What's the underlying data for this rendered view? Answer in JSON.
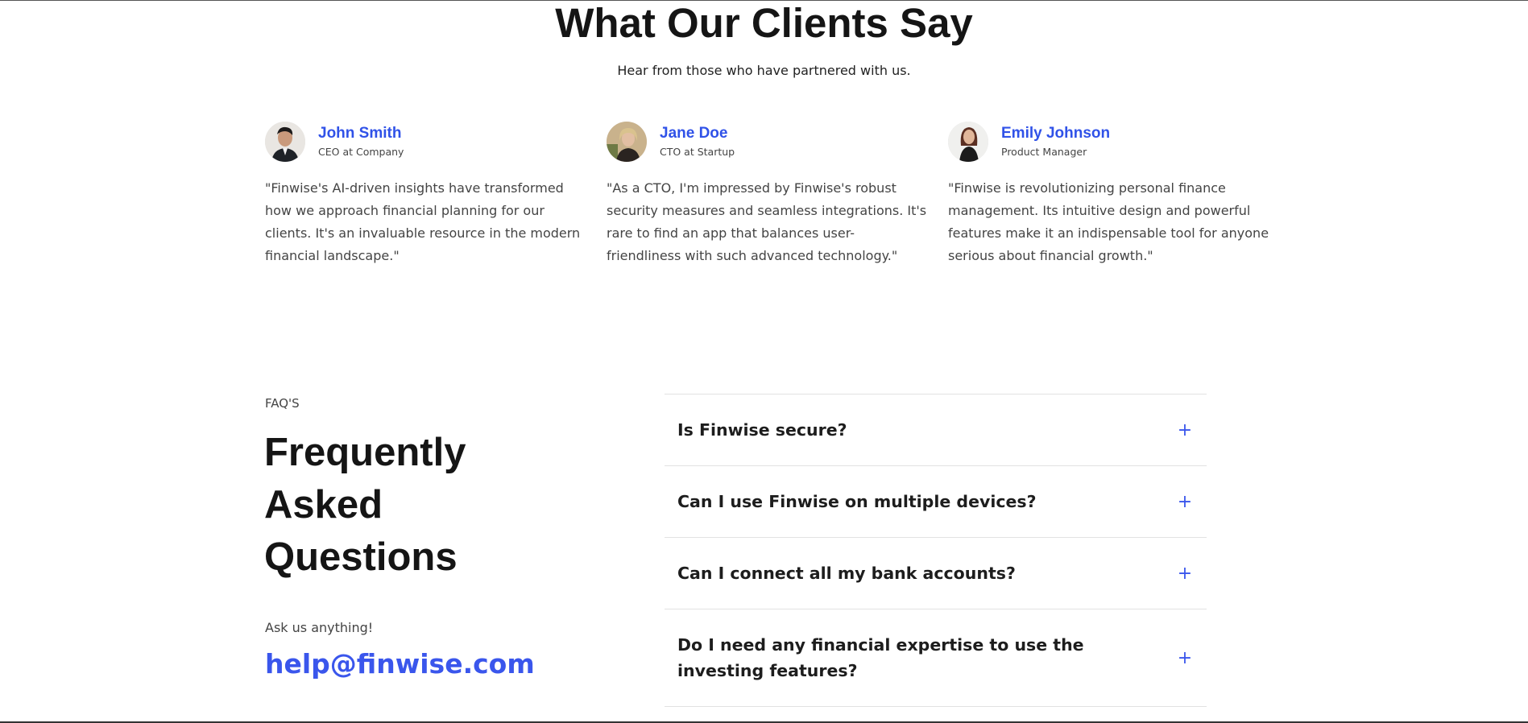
{
  "testimonials": {
    "title": "What Our Clients Say",
    "subtitle": "Hear from those who have partnered with us.",
    "items": [
      {
        "name": "John Smith",
        "role": "CEO at Company",
        "quote": "\"Finwise's AI-driven insights have transformed how we approach financial planning for our clients. It's an invaluable resource in the modern financial landscape.\"",
        "avatar_icon": "avatar-man-suit"
      },
      {
        "name": "Jane Doe",
        "role": "CTO at Startup",
        "quote": "\"As a CTO, I'm impressed by Finwise's robust security measures and seamless integrations. It's rare to find an app that balances user-friendliness with such advanced technology.\"",
        "avatar_icon": "avatar-woman-blonde"
      },
      {
        "name": "Emily Johnson",
        "role": "Product Manager",
        "quote": "\"Finwise is revolutionizing personal finance management. Its intuitive design and powerful features make it an indispensable tool for anyone serious about financial growth.\"",
        "avatar_icon": "avatar-woman-dark-hair"
      }
    ]
  },
  "faq": {
    "kicker": "FAQ'S",
    "title": "Frequently Asked Questions",
    "ask_label": "Ask us anything!",
    "email": "help@finwise.com",
    "expand_symbol": "+",
    "questions": [
      "Is Finwise secure?",
      "Can I use Finwise on multiple devices?",
      "Can I connect all my bank accounts?",
      "Do I need any financial expertise to use the investing features?"
    ]
  },
  "colors": {
    "accent": "#3a56ec",
    "name_blue": "#3052e8",
    "heading": "#151515",
    "body_text": "#444444"
  }
}
